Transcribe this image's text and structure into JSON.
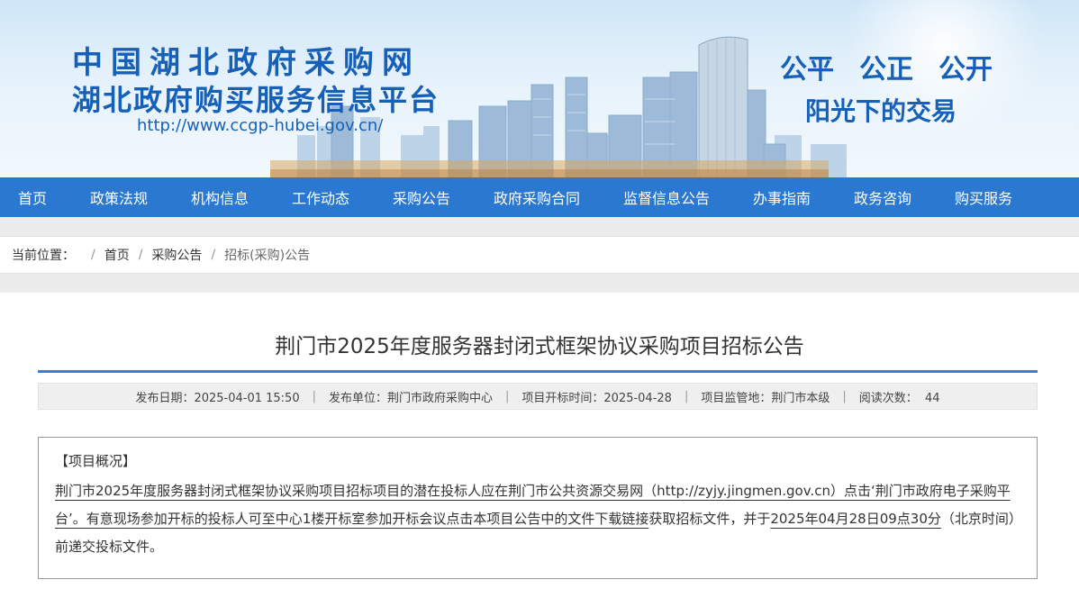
{
  "header": {
    "title_line1": "中国湖北政府采购网",
    "title_line2": "湖北政府购买服务信息平台",
    "url": "http://www.ccgp-hubei.gov.cn/",
    "slogans": [
      "公平",
      "公正",
      "公开"
    ],
    "tagline": "阳光下的交易"
  },
  "nav": {
    "items": [
      "首页",
      "政策法规",
      "机构信息",
      "工作动态",
      "采购公告",
      "政府采购合同",
      "监督信息公告",
      "办事指南",
      "政务咨询",
      "购买服务"
    ]
  },
  "breadcrumb": {
    "label": "当前位置：",
    "items": [
      "首页",
      "采购公告",
      "招标(采购)公告"
    ]
  },
  "article": {
    "title": "荆门市2025年度服务器封闭式框架协议采购项目招标公告",
    "meta": {
      "publish_date": "发布日期：2025-04-01 15:50",
      "publisher": "发布单位：荆门市政府采购中心",
      "open_time": "项目开标时间：2025-04-28",
      "region": "项目监管地：荆门市本级",
      "views": "阅读次数：  44"
    },
    "overview": {
      "heading": "【项目概况】",
      "body_underlined_1": "荆门市2025年度服务器封闭式框架协议采购项目招标项目的潜在投标人应在荆门市公共资源交易网（http://zyjy.jingmen.gov.cn）点击‘荆门市政府电子采购平台’。有意现场参加开标的投标人可至中心1楼开标室参加开标会议点击本项目公告中的文件下载链接",
      "body_plain_1": "获取招标文件，并于",
      "body_underlined_2": "2025年04月28日09点30分",
      "body_plain_2": "（北京时间）前递交投标文件。"
    }
  }
}
